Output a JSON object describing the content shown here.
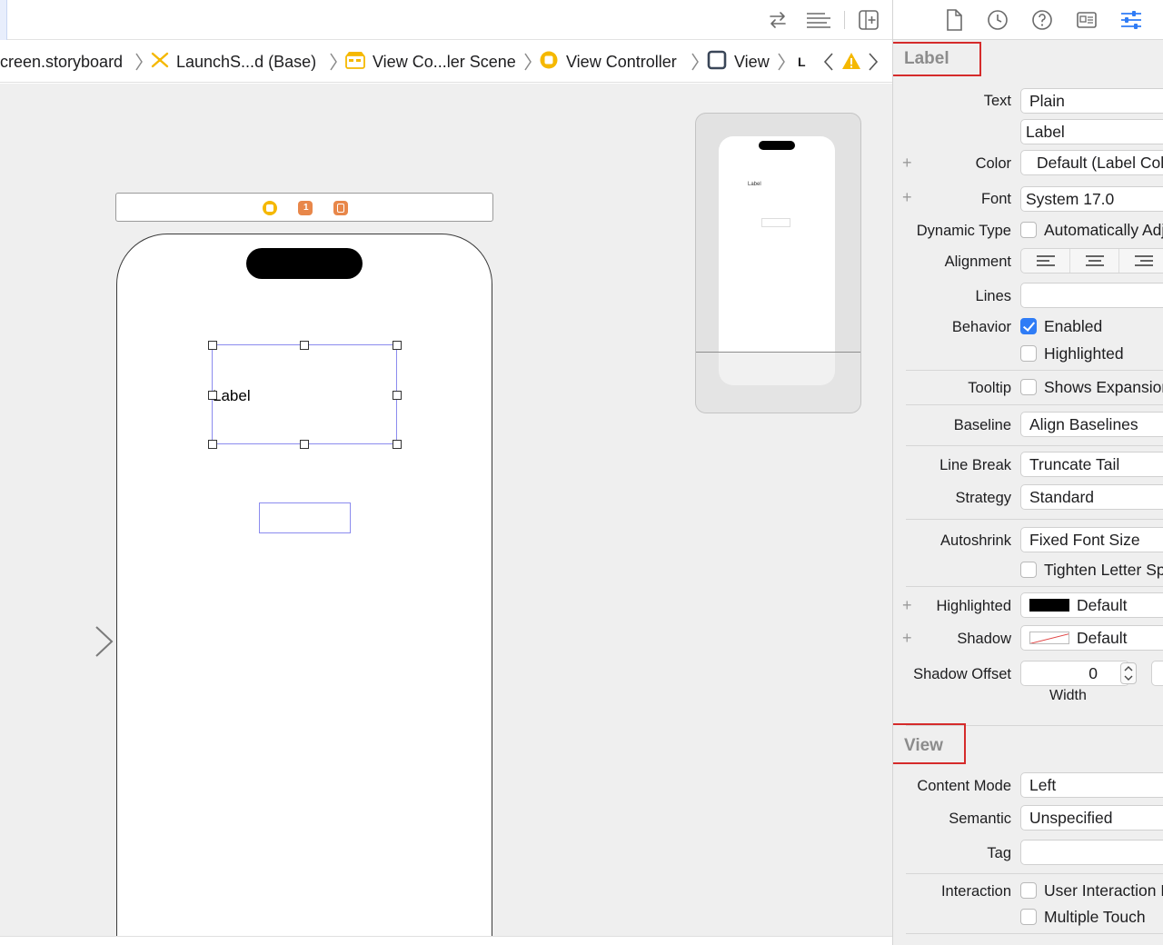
{
  "colors": {
    "accent": "#2f7cf6",
    "highlight_box": "#d52b2b",
    "selection": "#8b8bee",
    "warning": "#f5b800"
  },
  "toolbar": {
    "icons": [
      "swap-arrows-icon",
      "editor-options-icon",
      "add-editor-icon"
    ]
  },
  "breadcrumb": {
    "items": [
      {
        "label": "creen.storyboard",
        "icon": "storyboard-icon"
      },
      {
        "label": "LaunchS...d (Base)",
        "icon": "storyboard-base-icon"
      },
      {
        "label": "View Co...ler Scene",
        "icon": "scene-icon"
      },
      {
        "label": "View Controller",
        "icon": "view-controller-icon"
      },
      {
        "label": "View",
        "icon": "view-icon"
      },
      {
        "label": "L",
        "icon": "label-icon"
      }
    ]
  },
  "canvas": {
    "label_text": "Label",
    "minimap_label_text": "Label"
  },
  "inspector": {
    "tabs": [
      "file-icon",
      "history-icon",
      "help-icon",
      "identity-icon",
      "attributes-icon"
    ],
    "label_section": {
      "title": "Label",
      "text_label": "Text",
      "text_value": "Plain",
      "text_content": "Label",
      "color_label": "Color",
      "color_value": "Default (Label Color)",
      "font_label": "Font",
      "font_value": "System 17.0",
      "dynamic_type_label": "Dynamic Type",
      "dynamic_type_value": "Automatically Adjusts Font",
      "alignment_label": "Alignment",
      "lines_label": "Lines",
      "lines_value": "",
      "behavior_label": "Behavior",
      "enabled_label": "Enabled",
      "enabled_checked": true,
      "highlighted_label": "Highlighted",
      "highlighted_checked": false,
      "tooltip_label": "Tooltip",
      "tooltip_value": "Shows Expansion Tooltip",
      "baseline_label": "Baseline",
      "baseline_value": "Align Baselines",
      "line_break_label": "Line Break",
      "line_break_value": "Truncate Tail",
      "strategy_label": "Strategy",
      "strategy_value": "Standard",
      "autoshrink_label": "Autoshrink",
      "autoshrink_value": "Fixed Font Size",
      "tighten_label": "Tighten Letter Spacing",
      "highlighted_color_label": "Highlighted",
      "highlighted_color_value": "Default",
      "shadow_label": "Shadow",
      "shadow_value": "Default",
      "shadow_offset_label": "Shadow Offset",
      "shadow_offset_width": "0",
      "width_label": "Width"
    },
    "view_section": {
      "title": "View",
      "content_mode_label": "Content Mode",
      "content_mode_value": "Left",
      "semantic_label": "Semantic",
      "semantic_value": "Unspecified",
      "tag_label": "Tag",
      "tag_value": "",
      "interaction_label": "Interaction",
      "user_interaction_label": "User Interaction Enabled",
      "multiple_touch_label": "Multiple Touch"
    }
  }
}
